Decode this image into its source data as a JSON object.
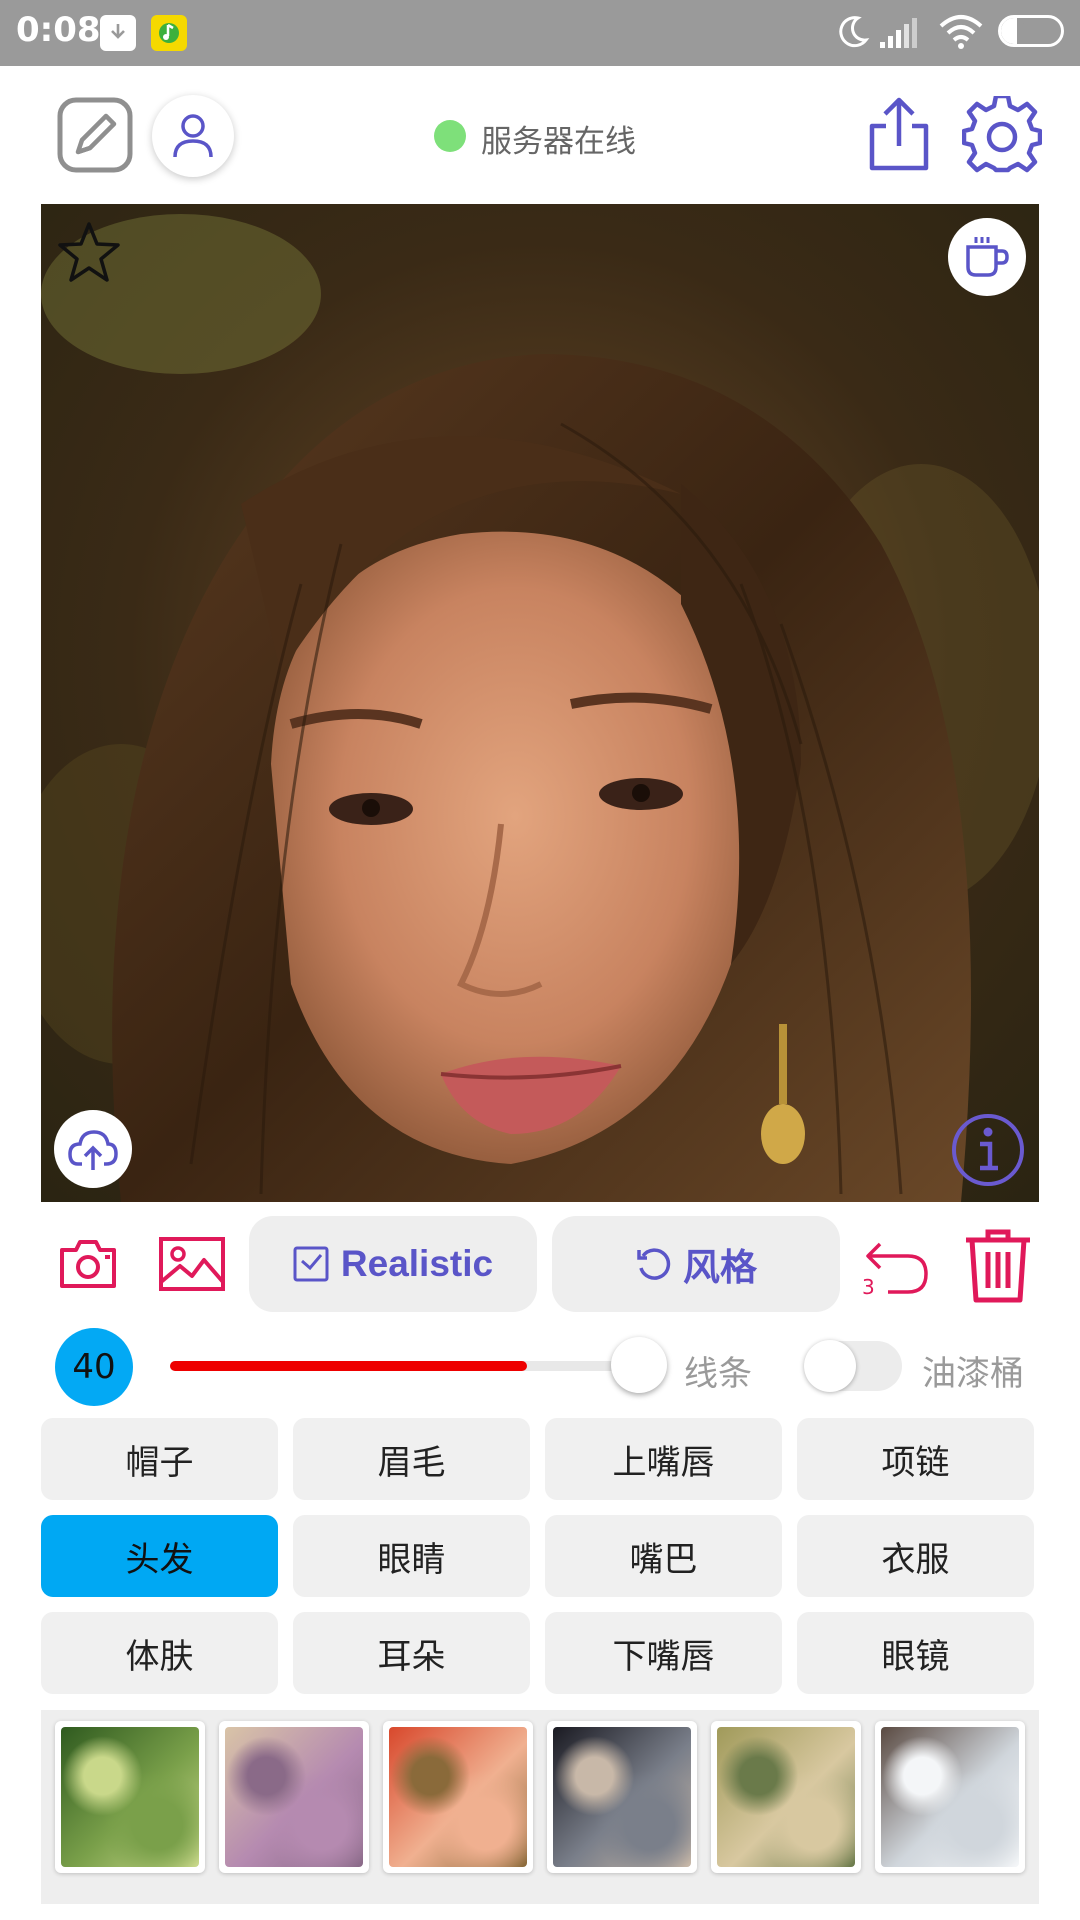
{
  "status_bar": {
    "time": "0:08",
    "battery_level": "27",
    "battery_fraction": 0.27,
    "icons": [
      "download-icon",
      "music-app-icon",
      "moon-icon",
      "signal-icon",
      "wifi-icon",
      "battery-icon"
    ]
  },
  "toolbar": {
    "server_status": "服务器在线",
    "server_status_color": "#7ee07a",
    "icons": [
      "edit-icon",
      "user-icon",
      "share-icon",
      "settings-icon"
    ]
  },
  "canvas": {
    "overlay_icons": [
      "star-icon",
      "coffee-icon",
      "upload-cloud-icon",
      "info-icon"
    ]
  },
  "actions": {
    "realistic_label": "Realistic",
    "style_label": "风格",
    "undo_count": "3",
    "accent_color": "#e0195a",
    "button_text_color": "#5a55c8",
    "icons": [
      "camera-icon",
      "gallery-icon",
      "checkbox-icon",
      "refresh-icon",
      "undo-icon",
      "trash-icon"
    ]
  },
  "brush": {
    "size": "40",
    "slider_fraction": 0.76,
    "line_label": "线条",
    "bucket_label": "油漆桶",
    "bucket_enabled": false
  },
  "parts": [
    {
      "label": "帽子",
      "selected": false
    },
    {
      "label": "眉毛",
      "selected": false
    },
    {
      "label": "上嘴唇",
      "selected": false
    },
    {
      "label": "项链",
      "selected": false
    },
    {
      "label": "头发",
      "selected": true
    },
    {
      "label": "眼睛",
      "selected": false
    },
    {
      "label": "嘴巴",
      "selected": false
    },
    {
      "label": "衣服",
      "selected": false
    },
    {
      "label": "体肤",
      "selected": false
    },
    {
      "label": "耳朵",
      "selected": false
    },
    {
      "label": "下嘴唇",
      "selected": false
    },
    {
      "label": "眼镜",
      "selected": false
    }
  ],
  "style_thumbnails": [
    {
      "name": "green-foliage-style",
      "colors": [
        "#2f5a1f",
        "#7aa04a",
        "#c9d88a"
      ]
    },
    {
      "name": "lavender-plaster-style",
      "colors": [
        "#d9c4a7",
        "#b58ab0",
        "#8a6a88"
      ]
    },
    {
      "name": "red-flower-tree-style",
      "colors": [
        "#d8482c",
        "#f0b090",
        "#8a6a3a"
      ]
    },
    {
      "name": "dark-smoke-style",
      "colors": [
        "#1a1a22",
        "#7a7f8a",
        "#c8b8a8"
      ]
    },
    {
      "name": "olive-blossom-style",
      "colors": [
        "#a09a5a",
        "#d8c8a0",
        "#6a7a4a"
      ]
    },
    {
      "name": "white-waves-style",
      "colors": [
        "#5a4a42",
        "#d0d6dc",
        "#f4f6f8"
      ]
    }
  ]
}
